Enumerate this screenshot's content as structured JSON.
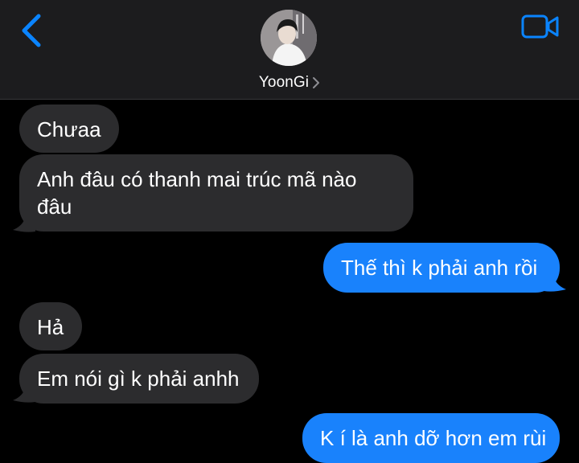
{
  "header": {
    "contact_name": "YoonGi"
  },
  "messages": [
    {
      "direction": "received",
      "text": "Chưaa"
    },
    {
      "direction": "received",
      "text_lines": [
        "Anh đâu có thanh mai trúc mã nào",
        "đâu"
      ]
    },
    {
      "direction": "sent",
      "text": "Thế thì k phải anh rồi"
    },
    {
      "direction": "received",
      "text": "Hả"
    },
    {
      "direction": "received",
      "text": "Em nói gì k phải anhh"
    },
    {
      "direction": "sent",
      "text": "K í là anh dỡ hơn em rùi"
    }
  ],
  "colors": {
    "accent": "#1982fc",
    "received_bubble": "#2c2c2e",
    "header_bg": "#1c1c1e",
    "icon_blue": "#0a84ff"
  },
  "icons": {
    "back": "chevron-left-icon",
    "video": "video-camera-icon",
    "chevron": "chevron-right-icon"
  }
}
